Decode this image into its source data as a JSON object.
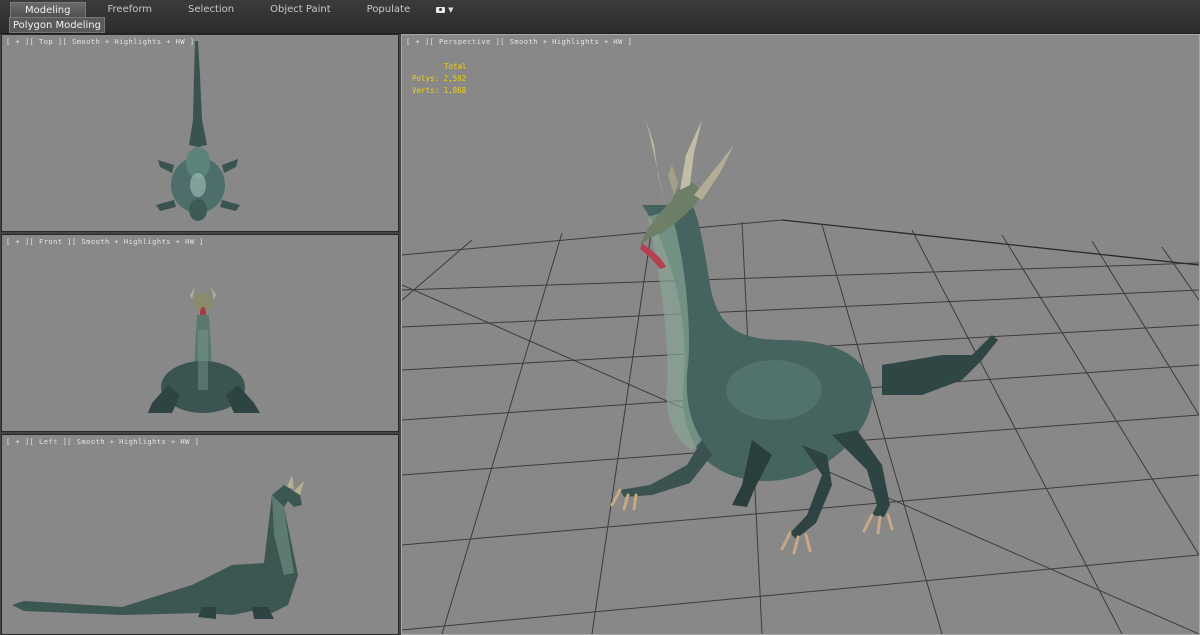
{
  "ribbon": {
    "tabs": [
      {
        "label": "Modeling",
        "active": true
      },
      {
        "label": "Freeform",
        "active": false
      },
      {
        "label": "Selection",
        "active": false
      },
      {
        "label": "Object Paint",
        "active": false
      },
      {
        "label": "Populate",
        "active": false
      }
    ],
    "subtab_label": "Polygon Modeling"
  },
  "viewports": {
    "top": {
      "label": "[ + ][ Top ][ Smooth + Highlights + HW ]"
    },
    "front": {
      "label": "[ + ][ Front ][ Smooth + Highlights + HW ]"
    },
    "left": {
      "label": "[ + ][ Left ][ Smooth + Highlights + HW ]"
    },
    "perspective": {
      "label": "[ + ][ Perspective ][ Smooth + Highlights + HW ]",
      "stats": {
        "header": "Total",
        "polys": "Polys: 2,592",
        "verts": "Verts: 1,868"
      }
    }
  },
  "colors": {
    "viewport_bg": "#888888",
    "stats_text": "#f2d000",
    "grid_line": "#3c3c3c",
    "dragon_body": "#4d6e6a"
  }
}
